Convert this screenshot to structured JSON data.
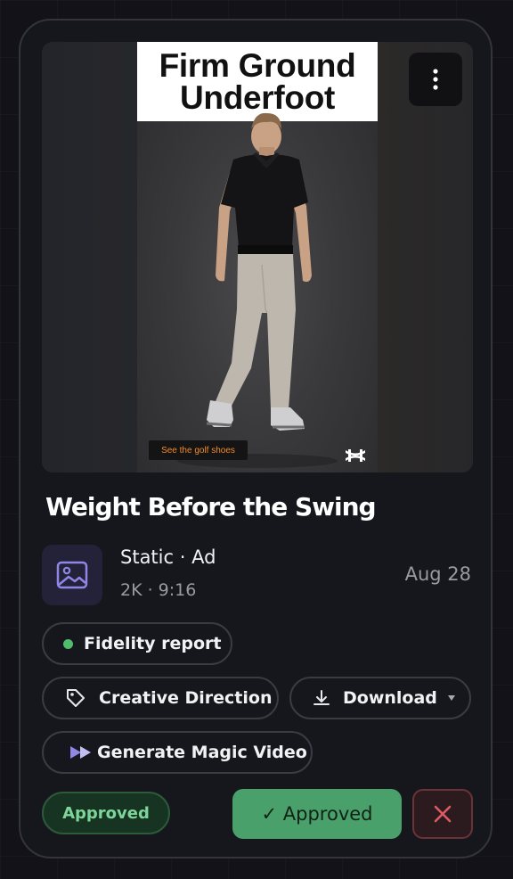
{
  "preview": {
    "poster_title": "Firm Ground Underfoot",
    "cta_text": "See the golf shoes"
  },
  "card": {
    "title": "Weight Before the Swing",
    "type_line": "Static · Ad",
    "spec_line": "2K · 9:16",
    "date": "Aug 28"
  },
  "actions": {
    "fidelity_report": "Fidelity report",
    "creative_direction": "Creative Direction",
    "download": "Download",
    "generate_video": "Generate Magic Video"
  },
  "status": {
    "badge": "Approved",
    "approve_button": "✓ Approved"
  },
  "icons": {
    "menu": "more-vertical-icon",
    "type": "image-icon",
    "tag": "tag-icon",
    "download": "download-icon",
    "caret": "caret-down-icon",
    "play": "double-play-icon",
    "reject": "close-icon",
    "brand": "brand-logo"
  },
  "colors": {
    "card_bg": "#16171d",
    "accent_green": "#4aa06a",
    "status_green": "#7ed59a",
    "reject_red": "#e05a63",
    "icon_purple": "#8f86e6",
    "cta_orange": "#f08a2c"
  }
}
